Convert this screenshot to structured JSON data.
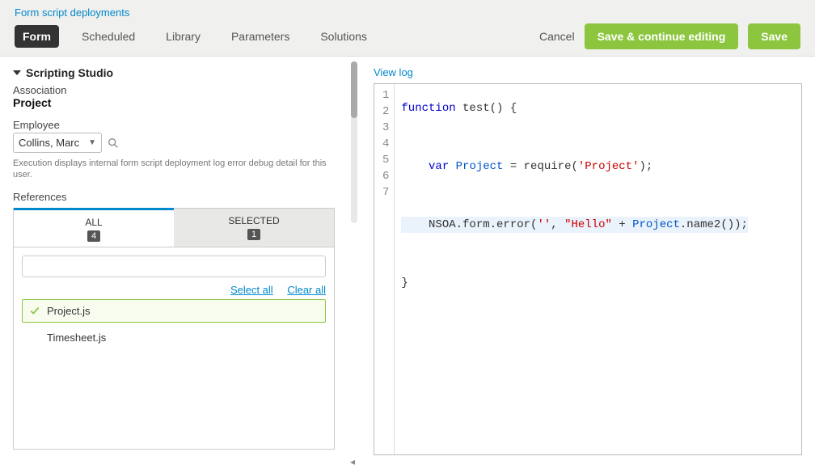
{
  "breadcrumb": "Form script deployments",
  "tabs": {
    "form": "Form",
    "scheduled": "Scheduled",
    "library": "Library",
    "parameters": "Parameters",
    "solutions": "Solutions"
  },
  "actions": {
    "cancel": "Cancel",
    "save_continue": "Save & continue editing",
    "save": "Save"
  },
  "left": {
    "section_title": "Scripting Studio",
    "association_label": "Association",
    "association_value": "Project",
    "employee_label": "Employee",
    "employee_value": "Collins, Marc",
    "hint": "Execution displays internal form script deployment log error debug detail for this user.",
    "references_label": "References",
    "ref_tabs": {
      "all_label": "ALL",
      "all_count": "4",
      "selected_label": "SELECTED",
      "selected_count": "1"
    },
    "ref_actions": {
      "select_all": "Select all",
      "clear_all": "Clear all"
    },
    "ref_items": {
      "project": "Project.js",
      "timesheet": "Timesheet.js"
    },
    "filter_placeholder": ""
  },
  "right": {
    "view_log": "View log",
    "code": {
      "l1_kw": "function",
      "l1_rest": " test() {",
      "l3_kw": "var",
      "l3_id": " Project",
      "l3_mid": " = require(",
      "l3_str": "'Project'",
      "l3_end": ");",
      "l5_a": "NSOA.form.error(",
      "l5_s1": "''",
      "l5_b": ", ",
      "l5_s2": "\"Hello\"",
      "l5_c": " + ",
      "l5_id": "Project",
      "l5_d": ".name2());",
      "l7": "}"
    }
  }
}
